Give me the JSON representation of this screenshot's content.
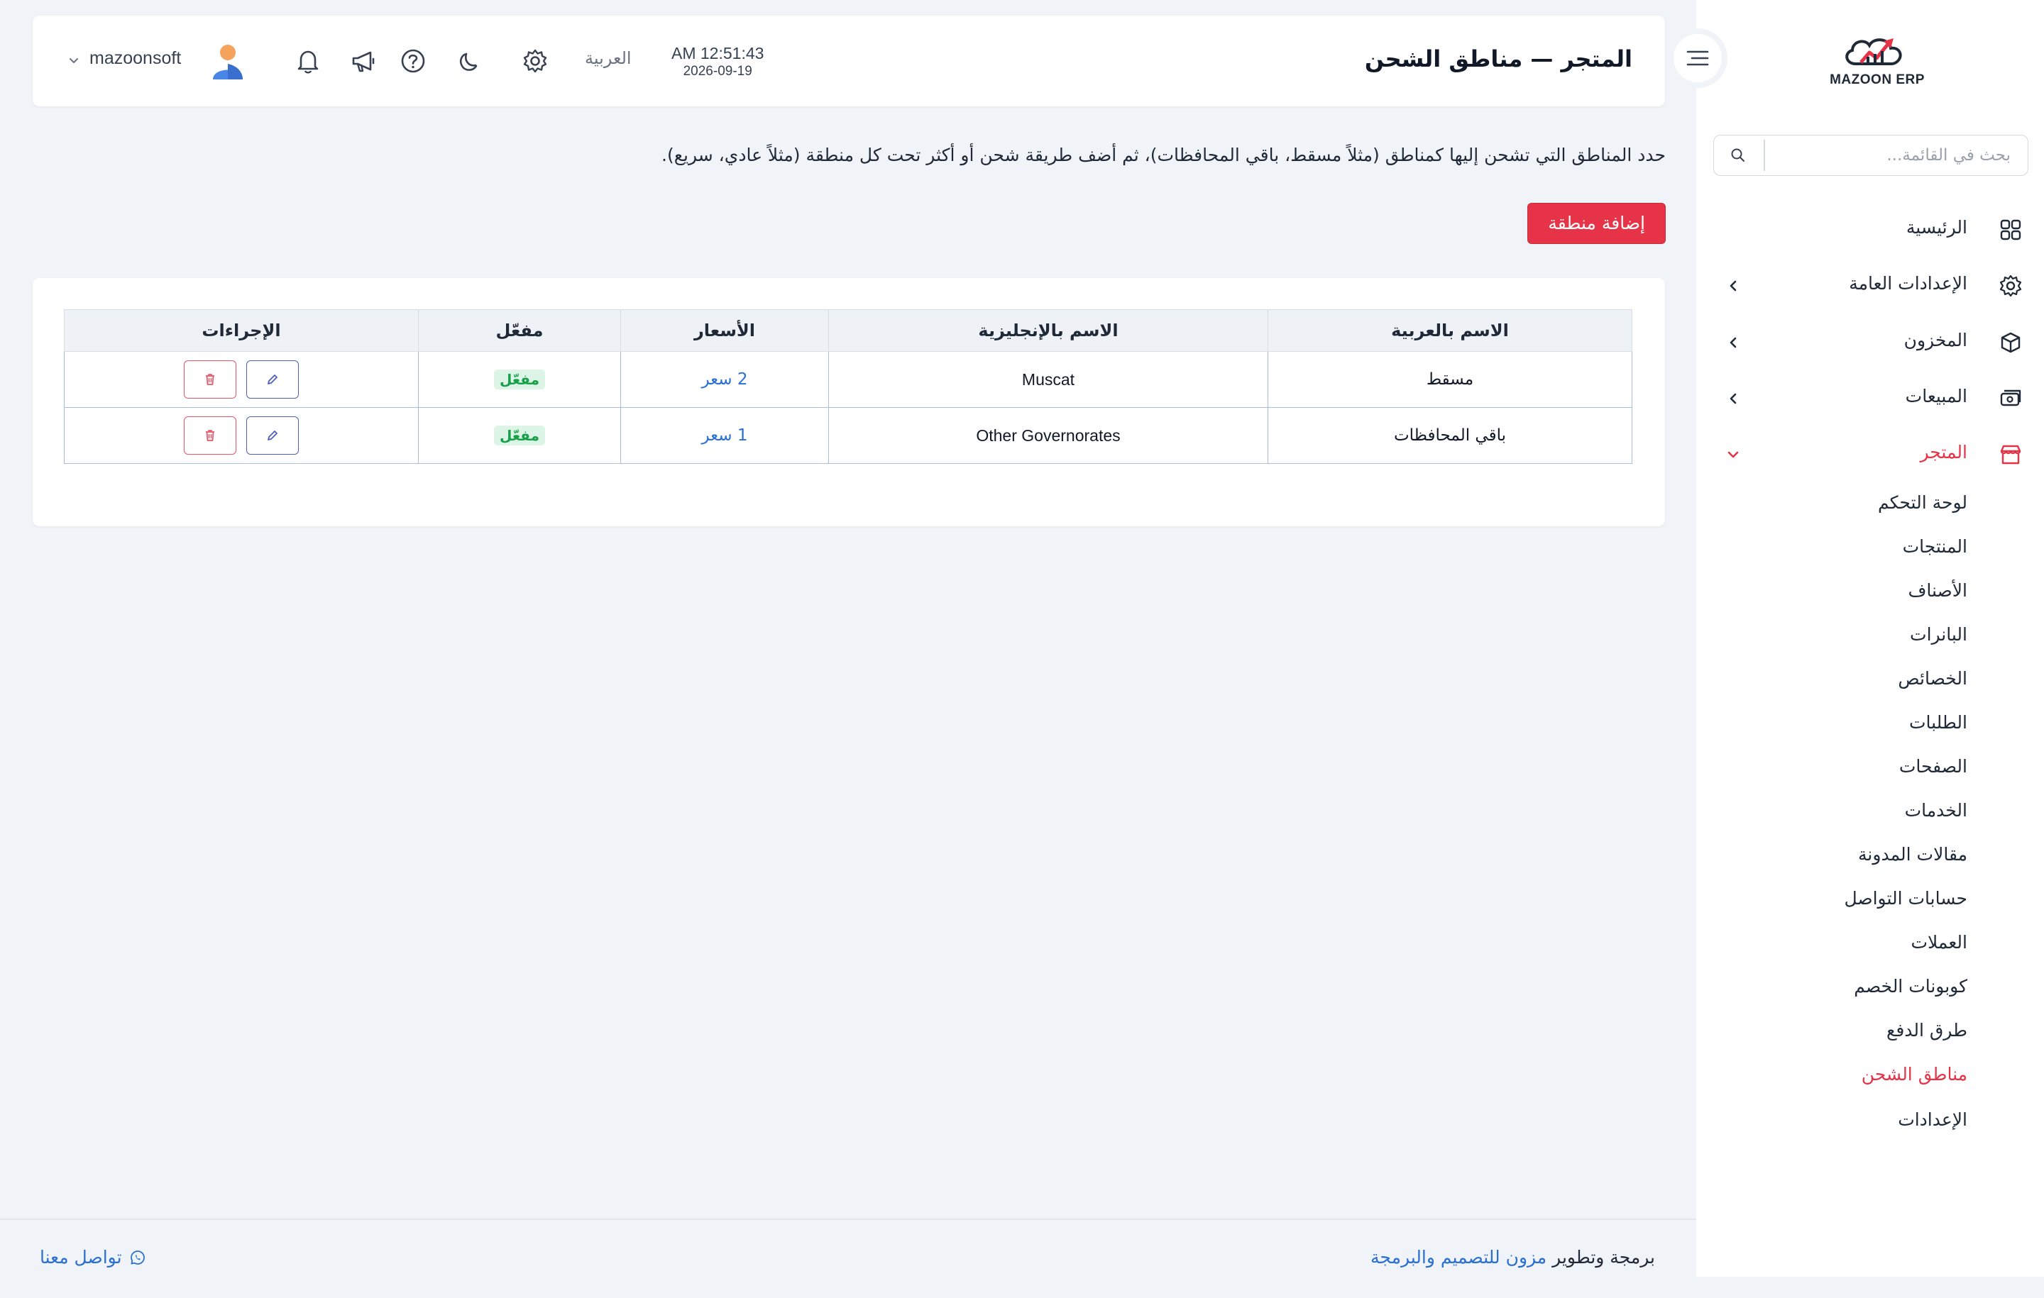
{
  "app": {
    "logo_text": "MAZOON ERP"
  },
  "sidebar": {
    "search_placeholder": "بحث في القائمة...",
    "items": [
      {
        "label": "الرئيسية",
        "icon": "grid-icon"
      },
      {
        "label": "الإعدادات العامة",
        "icon": "gear-icon"
      },
      {
        "label": "المخزون",
        "icon": "box-icon"
      },
      {
        "label": "المبيعات",
        "icon": "cash-icon"
      },
      {
        "label": "المتجر",
        "icon": "store-icon"
      }
    ],
    "store_sub": [
      "لوحة التحكم",
      "المنتجات",
      "الأصناف",
      "البانرات",
      "الخصائص",
      "الطلبات",
      "الصفحات",
      "الخدمات",
      "مقالات المدونة",
      "حسابات التواصل",
      "العملات",
      "كوبونات الخصم",
      "طرق الدفع",
      "مناطق الشحن",
      "الإعدادات"
    ]
  },
  "header": {
    "title": "المتجر — مناطق الشحن",
    "time": "AM 12:51:43",
    "date": "2026-09-19",
    "language": "العربية",
    "username": "mazoonsoft"
  },
  "main": {
    "description": "حدد المناطق التي تشحن إليها كمناطق (مثلاً مسقط، باقي المحافظات)، ثم أضف طريقة شحن أو أكثر تحت كل منطقة (مثلاً عادي، سريع).",
    "add_button": "إضافة منطقة",
    "table": {
      "headers": [
        "الاسم بالعربية",
        "الاسم بالإنجليزية",
        "الأسعار",
        "مفعّل",
        "الإجراءات"
      ],
      "rows": [
        {
          "name_ar": "مسقط",
          "name_en": "Muscat",
          "prices": "2 سعر",
          "enabled": "مفعّل"
        },
        {
          "name_ar": "باقي المحافظات",
          "name_en": "Other Governorates",
          "prices": "1 سعر",
          "enabled": "مفعّل"
        }
      ]
    }
  },
  "footer": {
    "credit_prefix": "برمجة وتطوير",
    "credit_link": "مزون للتصميم والبرمجة",
    "contact": "تواصل معنا"
  },
  "colors": {
    "accent": "#e63347",
    "link": "#2a6fd1",
    "success": "#18a04a",
    "background": "#f0f4f8"
  }
}
